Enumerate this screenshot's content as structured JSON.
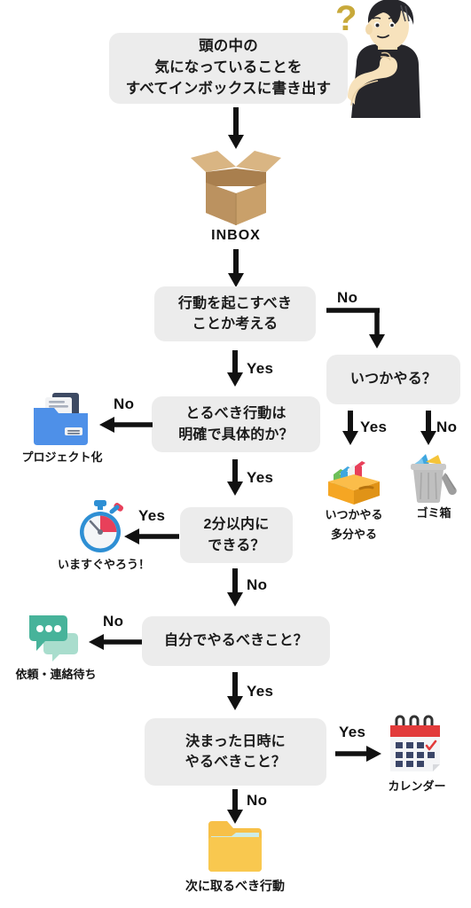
{
  "diagram": {
    "title_box": {
      "text": "頭の中の\n気になっていることを\nすべてインボックスに書き出す"
    },
    "inbox_label": "INBOX",
    "boxes": [
      {
        "id": "action-check",
        "text": "行動を起こすべき\nことか考える"
      },
      {
        "id": "someday",
        "text": "いつかやる？"
      },
      {
        "id": "clear-concrete",
        "text": "とるべき行動は\n明確で具体的か？"
      },
      {
        "id": "two-minutes",
        "text": "2分以内に\nできる？"
      },
      {
        "id": "do-it-myself",
        "text": "自分でやるべきこと？"
      },
      {
        "id": "scheduled",
        "text": "決まった日時に\nやるべきこと？"
      }
    ],
    "edge_labels": {
      "action_no": "No",
      "action_yes": "Yes",
      "someday_yes": "Yes",
      "someday_no": "No",
      "concrete_no": "No",
      "concrete_yes": "Yes",
      "twomin_yes": "Yes",
      "twomin_no": "No",
      "myself_no": "No",
      "myself_yes": "Yes",
      "scheduled_yes": "Yes",
      "scheduled_no": "No"
    },
    "outcomes": [
      {
        "id": "project",
        "icon": "blue-folder-documents-icon",
        "caption": "プロジェクト化"
      },
      {
        "id": "someday-maybe",
        "icon": "file-box-books-icon",
        "caption": "いつかやる\n多分やる"
      },
      {
        "id": "trash",
        "icon": "trash-can-icon",
        "caption": "ゴミ箱"
      },
      {
        "id": "do-now",
        "icon": "stopwatch-icon",
        "caption": "いますぐやろう！"
      },
      {
        "id": "waiting",
        "icon": "chat-bubbles-icon",
        "caption": "依頼・連絡待ち"
      },
      {
        "id": "calendar",
        "icon": "calendar-icon",
        "caption": "カレンダー"
      },
      {
        "id": "next-action",
        "icon": "orange-folder-icon",
        "caption": "次に取るべき行動"
      }
    ],
    "illustration": {
      "person": "thinking-person-illustration",
      "question_mark": "?"
    },
    "colors": {
      "box_bg": "#ececec",
      "arrow": "#111111",
      "project_blue": "#4e90e8",
      "someday_orange": "#f5a623",
      "trash_gray": "#b9b9b9",
      "stopwatch_blue": "#2e8fd4",
      "stopwatch_red": "#e8405a",
      "chat_teal": "#47b39a",
      "calendar_red": "#e23b3b",
      "calendar_navy": "#3b4668",
      "folder_yellow": "#f7c048",
      "qmark_gold": "#c8a93a",
      "box_brown": "#c9a06a",
      "box_brown_light": "#d9b583",
      "box_brown_dark": "#a97f4e"
    }
  }
}
